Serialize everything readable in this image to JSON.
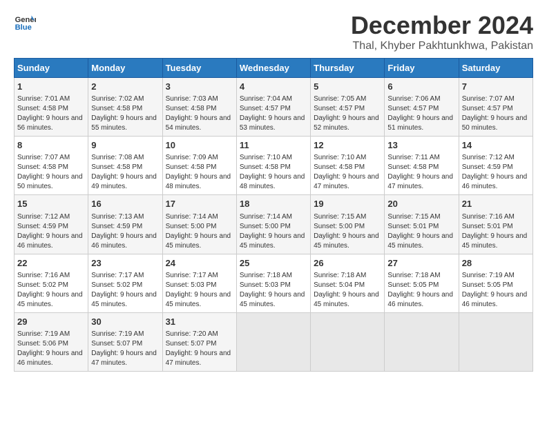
{
  "header": {
    "logo_line1": "General",
    "logo_line2": "Blue",
    "title": "December 2024",
    "subtitle": "Thal, Khyber Pakhtunkhwa, Pakistan"
  },
  "days_of_week": [
    "Sunday",
    "Monday",
    "Tuesday",
    "Wednesday",
    "Thursday",
    "Friday",
    "Saturday"
  ],
  "weeks": [
    [
      {
        "day": 1,
        "sunrise": "7:01 AM",
        "sunset": "4:58 PM",
        "daylight": "9 hours and 56 minutes."
      },
      {
        "day": 2,
        "sunrise": "7:02 AM",
        "sunset": "4:58 PM",
        "daylight": "9 hours and 55 minutes."
      },
      {
        "day": 3,
        "sunrise": "7:03 AM",
        "sunset": "4:58 PM",
        "daylight": "9 hours and 54 minutes."
      },
      {
        "day": 4,
        "sunrise": "7:04 AM",
        "sunset": "4:57 PM",
        "daylight": "9 hours and 53 minutes."
      },
      {
        "day": 5,
        "sunrise": "7:05 AM",
        "sunset": "4:57 PM",
        "daylight": "9 hours and 52 minutes."
      },
      {
        "day": 6,
        "sunrise": "7:06 AM",
        "sunset": "4:57 PM",
        "daylight": "9 hours and 51 minutes."
      },
      {
        "day": 7,
        "sunrise": "7:07 AM",
        "sunset": "4:57 PM",
        "daylight": "9 hours and 50 minutes."
      }
    ],
    [
      {
        "day": 8,
        "sunrise": "7:07 AM",
        "sunset": "4:58 PM",
        "daylight": "9 hours and 50 minutes."
      },
      {
        "day": 9,
        "sunrise": "7:08 AM",
        "sunset": "4:58 PM",
        "daylight": "9 hours and 49 minutes."
      },
      {
        "day": 10,
        "sunrise": "7:09 AM",
        "sunset": "4:58 PM",
        "daylight": "9 hours and 48 minutes."
      },
      {
        "day": 11,
        "sunrise": "7:10 AM",
        "sunset": "4:58 PM",
        "daylight": "9 hours and 48 minutes."
      },
      {
        "day": 12,
        "sunrise": "7:10 AM",
        "sunset": "4:58 PM",
        "daylight": "9 hours and 47 minutes."
      },
      {
        "day": 13,
        "sunrise": "7:11 AM",
        "sunset": "4:58 PM",
        "daylight": "9 hours and 47 minutes."
      },
      {
        "day": 14,
        "sunrise": "7:12 AM",
        "sunset": "4:59 PM",
        "daylight": "9 hours and 46 minutes."
      }
    ],
    [
      {
        "day": 15,
        "sunrise": "7:12 AM",
        "sunset": "4:59 PM",
        "daylight": "9 hours and 46 minutes."
      },
      {
        "day": 16,
        "sunrise": "7:13 AM",
        "sunset": "4:59 PM",
        "daylight": "9 hours and 46 minutes."
      },
      {
        "day": 17,
        "sunrise": "7:14 AM",
        "sunset": "5:00 PM",
        "daylight": "9 hours and 45 minutes."
      },
      {
        "day": 18,
        "sunrise": "7:14 AM",
        "sunset": "5:00 PM",
        "daylight": "9 hours and 45 minutes."
      },
      {
        "day": 19,
        "sunrise": "7:15 AM",
        "sunset": "5:00 PM",
        "daylight": "9 hours and 45 minutes."
      },
      {
        "day": 20,
        "sunrise": "7:15 AM",
        "sunset": "5:01 PM",
        "daylight": "9 hours and 45 minutes."
      },
      {
        "day": 21,
        "sunrise": "7:16 AM",
        "sunset": "5:01 PM",
        "daylight": "9 hours and 45 minutes."
      }
    ],
    [
      {
        "day": 22,
        "sunrise": "7:16 AM",
        "sunset": "5:02 PM",
        "daylight": "9 hours and 45 minutes."
      },
      {
        "day": 23,
        "sunrise": "7:17 AM",
        "sunset": "5:02 PM",
        "daylight": "9 hours and 45 minutes."
      },
      {
        "day": 24,
        "sunrise": "7:17 AM",
        "sunset": "5:03 PM",
        "daylight": "9 hours and 45 minutes."
      },
      {
        "day": 25,
        "sunrise": "7:18 AM",
        "sunset": "5:03 PM",
        "daylight": "9 hours and 45 minutes."
      },
      {
        "day": 26,
        "sunrise": "7:18 AM",
        "sunset": "5:04 PM",
        "daylight": "9 hours and 45 minutes."
      },
      {
        "day": 27,
        "sunrise": "7:18 AM",
        "sunset": "5:05 PM",
        "daylight": "9 hours and 46 minutes."
      },
      {
        "day": 28,
        "sunrise": "7:19 AM",
        "sunset": "5:05 PM",
        "daylight": "9 hours and 46 minutes."
      }
    ],
    [
      {
        "day": 29,
        "sunrise": "7:19 AM",
        "sunset": "5:06 PM",
        "daylight": "9 hours and 46 minutes."
      },
      {
        "day": 30,
        "sunrise": "7:19 AM",
        "sunset": "5:07 PM",
        "daylight": "9 hours and 47 minutes."
      },
      {
        "day": 31,
        "sunrise": "7:20 AM",
        "sunset": "5:07 PM",
        "daylight": "9 hours and 47 minutes."
      },
      null,
      null,
      null,
      null
    ]
  ]
}
